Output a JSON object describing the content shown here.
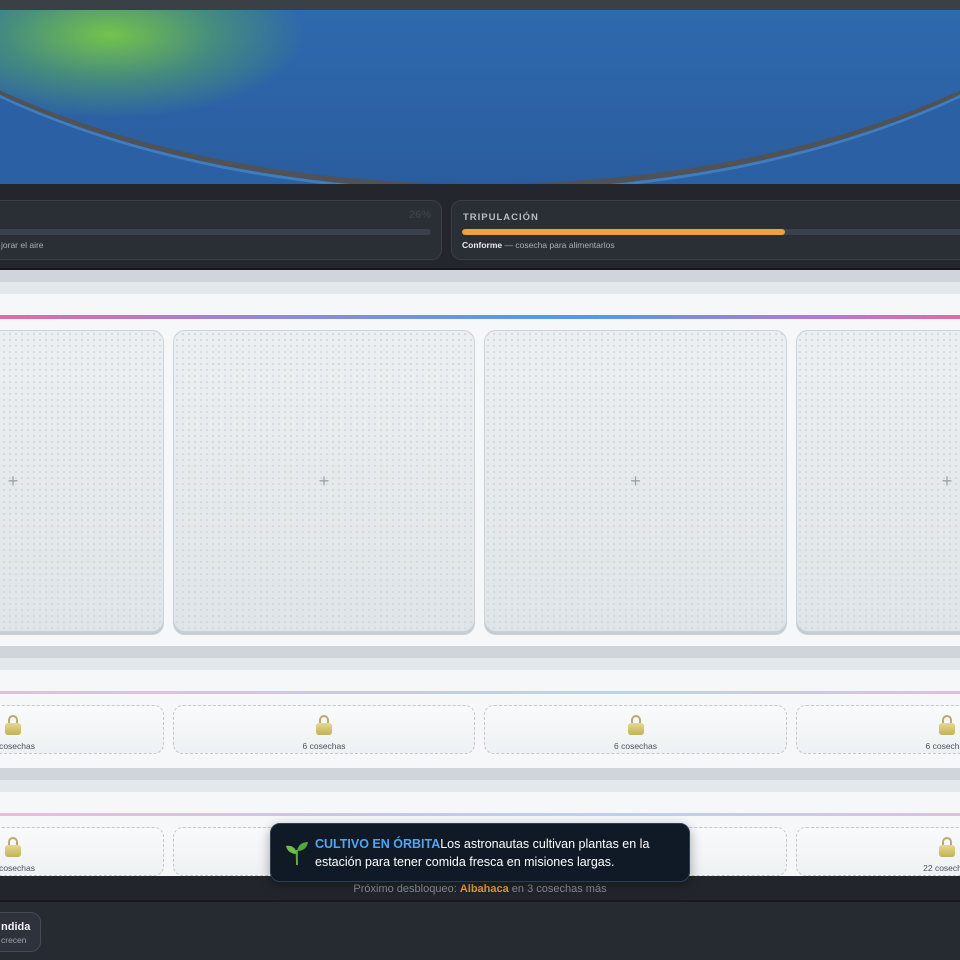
{
  "stats": {
    "air": {
      "percent_label": "26%",
      "fill": 0.03,
      "subtitle": "jorar el aire"
    },
    "crew": {
      "title": "TRIPULACIÓN",
      "fill": 0.6,
      "status": "Conforme",
      "subtitle": " — cosecha para alimentarlos"
    }
  },
  "garden": {
    "row1_pots": [
      {
        "label": "+"
      },
      {
        "label": "+"
      },
      {
        "label": "+"
      },
      {
        "label": "+"
      }
    ],
    "row2_locked": [
      {
        "label": "cosechas"
      },
      {
        "label": "6 cosechas"
      },
      {
        "label": "6 cosechas"
      },
      {
        "label": "6 cosechas"
      }
    ],
    "row3_locked": [
      {
        "label": "cosechas"
      },
      {
        "label": ""
      },
      {
        "label": ""
      },
      {
        "label": "22 cosechas"
      }
    ]
  },
  "toast": {
    "icon": "sprout-icon",
    "heading": "CULTIVO EN ÓRBITA",
    "message": "Los astronautas cultivan plantas en la estación para tener comida fresca en misiones largas."
  },
  "unlock": {
    "prefix": "Próximo desbloqueo: ",
    "item": "Albahaca",
    "suffix": " en 3 cosechas más"
  },
  "mode": {
    "title": "ndida",
    "subtitle": "crecen"
  },
  "colors": {
    "accent_green": "#39d07a",
    "accent_orange": "#eda23e",
    "toast_blue": "#53a4f5"
  }
}
